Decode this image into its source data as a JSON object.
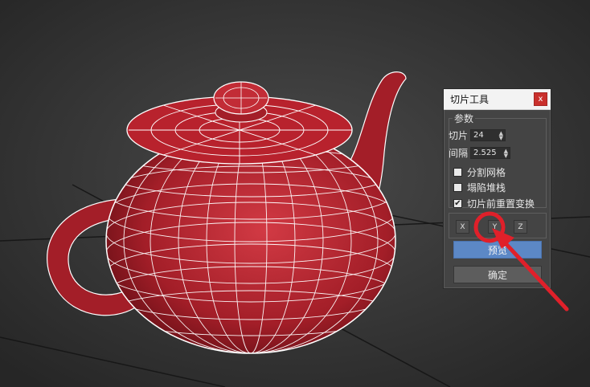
{
  "dialog": {
    "title": "切片工具",
    "close_label": "x",
    "group_label": "参数",
    "slices": {
      "label": "切片",
      "value": "24"
    },
    "spacing": {
      "label": "间隔",
      "value": "2.525"
    },
    "checkboxes": [
      {
        "label": "分割网格",
        "checked": false
      },
      {
        "label": "塌陷堆栈",
        "checked": false
      },
      {
        "label": "切片前重置变换",
        "checked": true
      }
    ],
    "axis_buttons": [
      "X",
      "Y",
      "Z"
    ],
    "preview_label": "预览",
    "ok_label": "确定"
  },
  "colors": {
    "teapot": "#b8222d",
    "wire": "#ffffff",
    "preview_button": "#5c88c6",
    "annotation": "#e0202a"
  }
}
